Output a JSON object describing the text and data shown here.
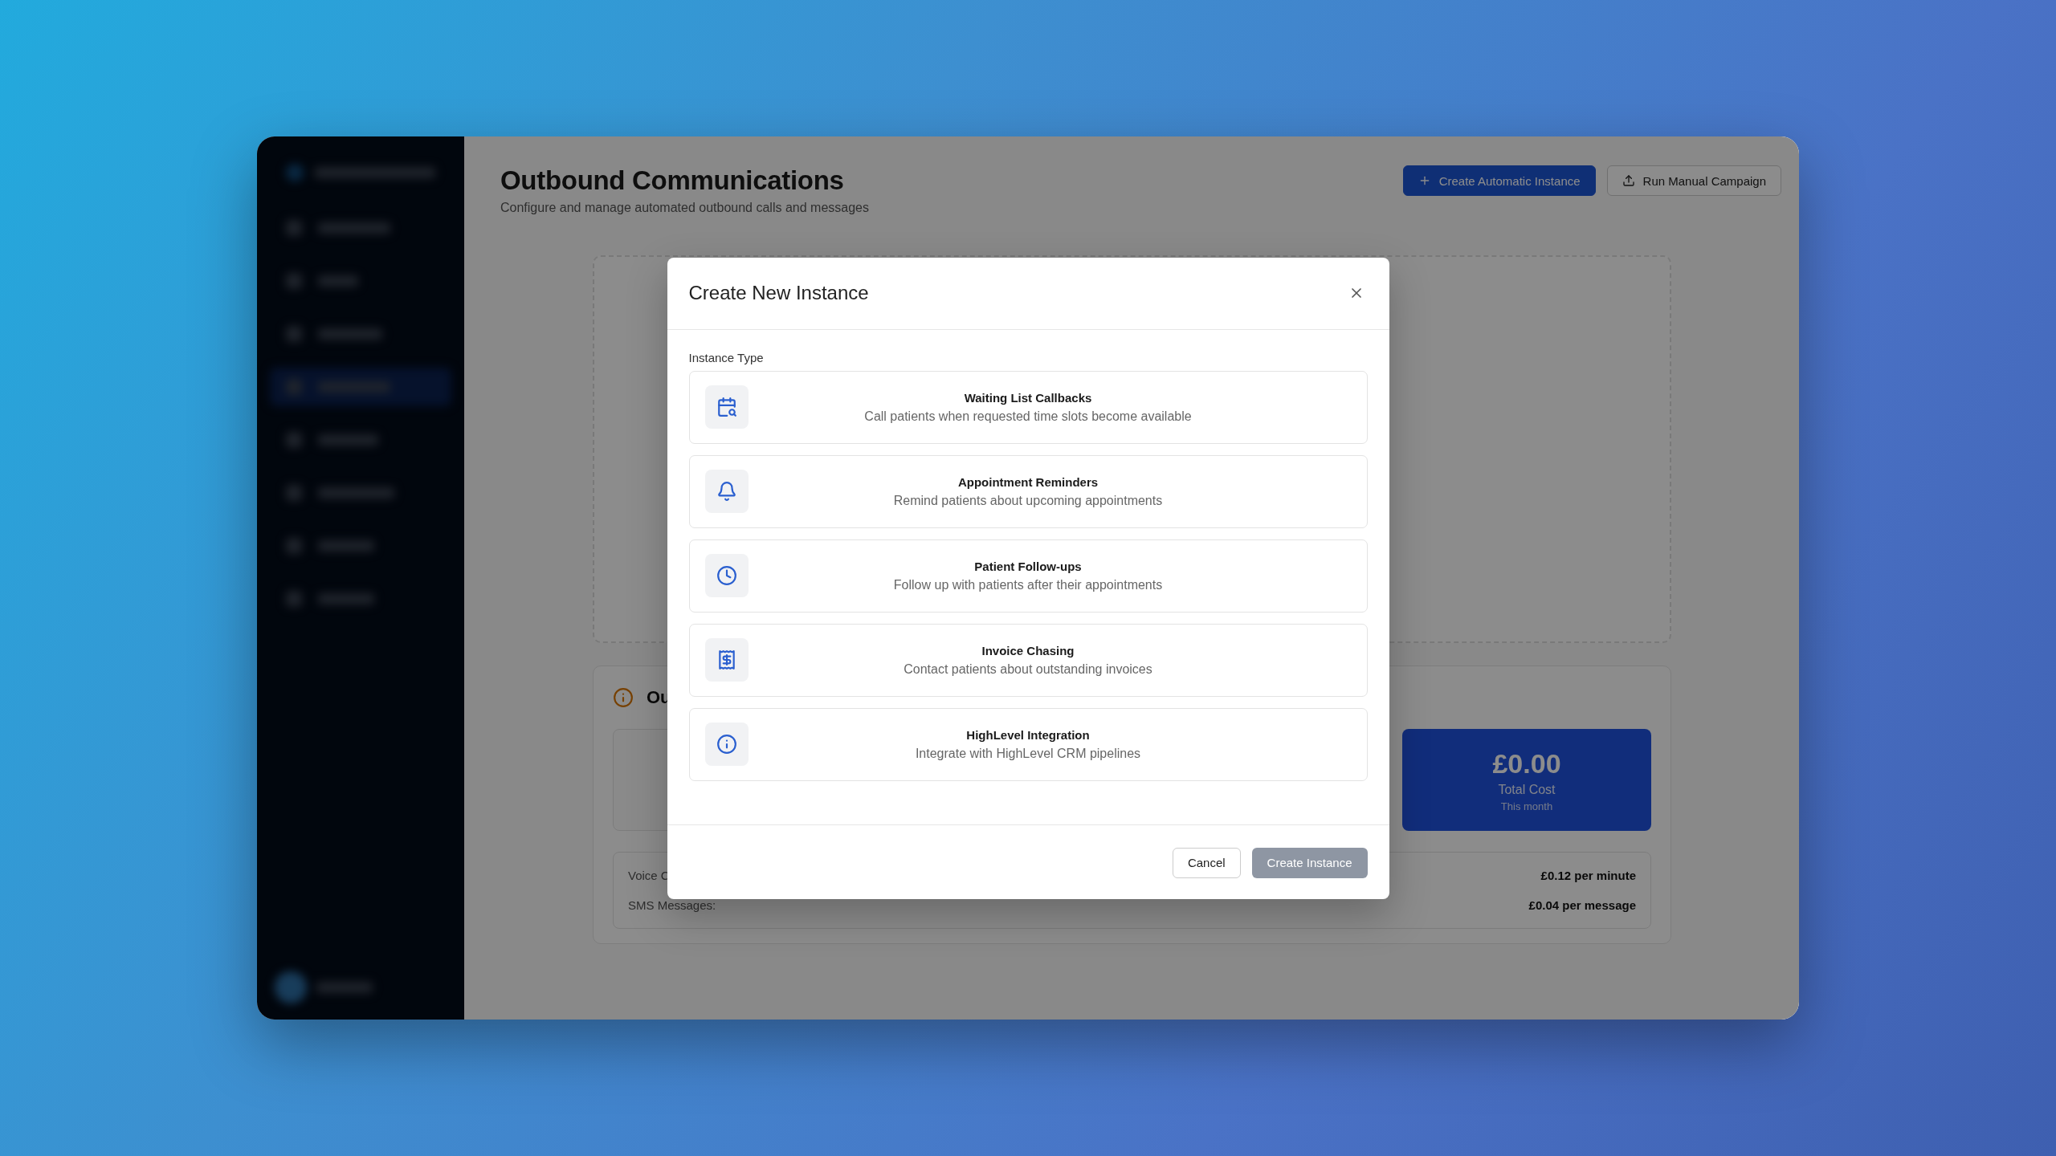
{
  "sidebar": {
    "items": [
      {
        "selected": false
      },
      {
        "selected": false
      },
      {
        "selected": false
      },
      {
        "selected": true
      },
      {
        "selected": false
      },
      {
        "selected": false
      },
      {
        "selected": false
      },
      {
        "selected": false
      }
    ]
  },
  "page": {
    "title": "Outbound Communications",
    "subtitle": "Configure and manage automated outbound calls and messages"
  },
  "header_buttons": [
    {
      "label": "Create Automatic Instance",
      "kind": "primary"
    },
    {
      "label": "Run Manual Campaign",
      "kind": "secondary"
    }
  ],
  "overview": {
    "title": "Ou",
    "total_cost": {
      "value": "£0.00",
      "label": "Total Cost",
      "period": "This month"
    },
    "pricing": [
      {
        "label": "Voice C",
        "price": "£0.12 per minute"
      },
      {
        "label": "SMS Messages:",
        "price": "£0.04 per message"
      }
    ]
  },
  "modal": {
    "title": "Create New Instance",
    "field_label": "Instance Type",
    "options": [
      {
        "title": "Waiting List Callbacks",
        "description": "Call patients when requested time slots become available",
        "selected": false
      },
      {
        "title": "Appointment Reminders",
        "description": "Remind patients about upcoming appointments",
        "selected": false
      },
      {
        "title": "Patient Follow-ups",
        "description": "Follow up with patients after their appointments",
        "selected": false
      },
      {
        "title": "Invoice Chasing",
        "description": "Contact patients about outstanding invoices",
        "selected": false
      },
      {
        "title": "HighLevel Integration",
        "description": "Integrate with HighLevel CRM pipelines",
        "selected": false
      }
    ],
    "cancel": {
      "label": "Cancel",
      "disabled": false
    },
    "submit": {
      "label": "Create Instance",
      "disabled": true
    }
  }
}
